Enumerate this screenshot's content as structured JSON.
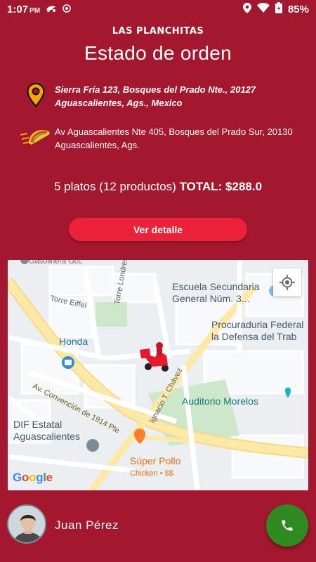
{
  "status_bar": {
    "time": "1:07",
    "ampm": "PM",
    "battery": "85%",
    "icons": [
      "motorcycle-notification-icon",
      "record-icon",
      "location-icon",
      "wifi-icon",
      "battery-icon"
    ]
  },
  "header": {
    "brand": "LAS PLANCHITAS",
    "title": "Estado de orden"
  },
  "addresses": {
    "delivery": {
      "icon": "map-pin-icon",
      "text": "Sierra Fría 123, Bosques del Prado Nte., 20127 Aguascalientes, Ags., Mexico"
    },
    "restaurant": {
      "icon": "taco-icon",
      "text": "Av Aguascalientes Nte 405, Bosques del Prado Sur, 20130 Aguascalientes, Ags."
    }
  },
  "summary": {
    "items": "5 platos (12 productos)",
    "total": "TOTAL: $288.0"
  },
  "detail_button": "Ver detalle",
  "map": {
    "labels": {
      "school": "Escuela Secundaria\nGeneral Núm. 3...",
      "procuraduria": "Procuraduria Federal\nla Defensa del Trab",
      "honda": "Honda",
      "auditorio": "Auditorio Morelos",
      "dif": "DIF Estatal\nAguascalientes",
      "super_pollo": "Súper Pollo",
      "super_pollo_sub": "Chicken • $$",
      "torre_eiffel": "Torre Eiffel",
      "torre_londres": "Torre Londres",
      "av_convencion": "Av. Convención de 1914 Pte",
      "ignacio": "Ignacio T. Chávez",
      "gasolinera": "Gasolinera Gcc",
      "google": "Google"
    }
  },
  "driver": {
    "name": "Juan Pérez"
  },
  "colors": {
    "background": "#a3172f",
    "accent_button": "#ec2238",
    "call_button": "#2e8b1f"
  }
}
